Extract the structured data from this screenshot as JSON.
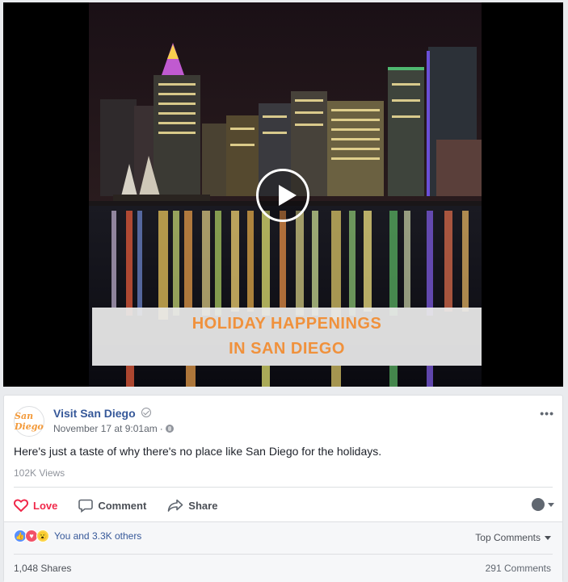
{
  "video": {
    "banner_line1": "HOLIDAY HAPPENINGS",
    "banner_line2": "IN SAN DIEGO",
    "play_icon": "play-icon"
  },
  "post": {
    "avatar_text": "San Diego",
    "page_name": "Visit San Diego",
    "date": "November 17 at 9:01am",
    "privacy_icon": "globe-icon",
    "more_label": "•••",
    "text": "Here's just a taste of why there's no place like San Diego for the holidays.",
    "views": "102K Views"
  },
  "actions": {
    "love": "Love",
    "comment": "Comment",
    "share": "Share"
  },
  "social": {
    "reactions_text": "You and 3.3K others",
    "top_comments": "Top Comments",
    "shares": "1,048 Shares",
    "comments": "291 Comments"
  },
  "colors": {
    "link": "#365899",
    "love": "#f0284a",
    "banner_text": "#f0913c"
  }
}
